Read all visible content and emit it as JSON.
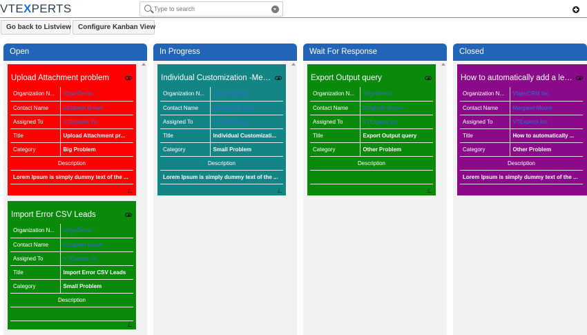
{
  "header": {
    "logo": {
      "prefix": "VTE",
      "accent": "X",
      "suffix": "PERTS"
    },
    "search": {
      "placeholder": "Type to search",
      "value": ""
    }
  },
  "toolbar": {
    "back_label": "Go back to Listview",
    "config_label": "Configure Kanban View"
  },
  "labels": {
    "org": "Organization N...",
    "contact": "Contact Name",
    "assigned": "Assigned To",
    "title": "Title",
    "category": "Category",
    "description": "Description"
  },
  "colors": {
    "column_header": "#2265b8",
    "red": "#ff0000",
    "green": "#0a8a0a",
    "teal": "#138585",
    "purple": "#8a0a8a",
    "link": "#2a6fd6"
  },
  "columns": [
    {
      "title": "Open",
      "cards": [
        {
          "title": "Upload Attachment problem",
          "org": "VtigerDemo",
          "contact": "Elizabeth Brown",
          "assigned": "VTExperts Inc",
          "ticket_title": "Upload Attachment pr...",
          "category": "Big Problem",
          "description": "Lorem Ipsum is simply dummy text of the ..."
        },
        {
          "title": "Import Error CSV Leads",
          "org": "VtigerDemo",
          "contact": "Elizabeth Brown",
          "assigned": "VTExperts Inc",
          "ticket_title": "Import Error CSV Leads",
          "category": "Small Problem",
          "description": ""
        }
      ]
    },
    {
      "title": "In Progress",
      "cards": [
        {
          "title": "Individual Customization -Menu...",
          "org": "VtigerCRM Inc",
          "contact": "Elizabeth Brown",
          "assigned": "VTExperts Inc",
          "ticket_title": "Individual Customizati...",
          "category": "Small Problem",
          "description": "Lorem Ipsum is simply dummy text of the ..."
        }
      ]
    },
    {
      "title": "Wait For Response",
      "cards": [
        {
          "title": "Export Output query",
          "org": "VtigerDemo",
          "contact": "Elizabeth Brown",
          "assigned": "VTExperts Inc",
          "ticket_title": "Export Output query",
          "category": "Other Problem",
          "description": ""
        }
      ]
    },
    {
      "title": "Closed",
      "cards": [
        {
          "title": "How to automatically add a lead...",
          "org": "VtigerCRM Inc",
          "contact": "Margaret Moore",
          "assigned": "VTExperts Inc",
          "ticket_title": "How to automatically ...",
          "category": "Other Problem",
          "description": "Lorem Ipsum is simply dummy text of the ..."
        }
      ]
    }
  ]
}
